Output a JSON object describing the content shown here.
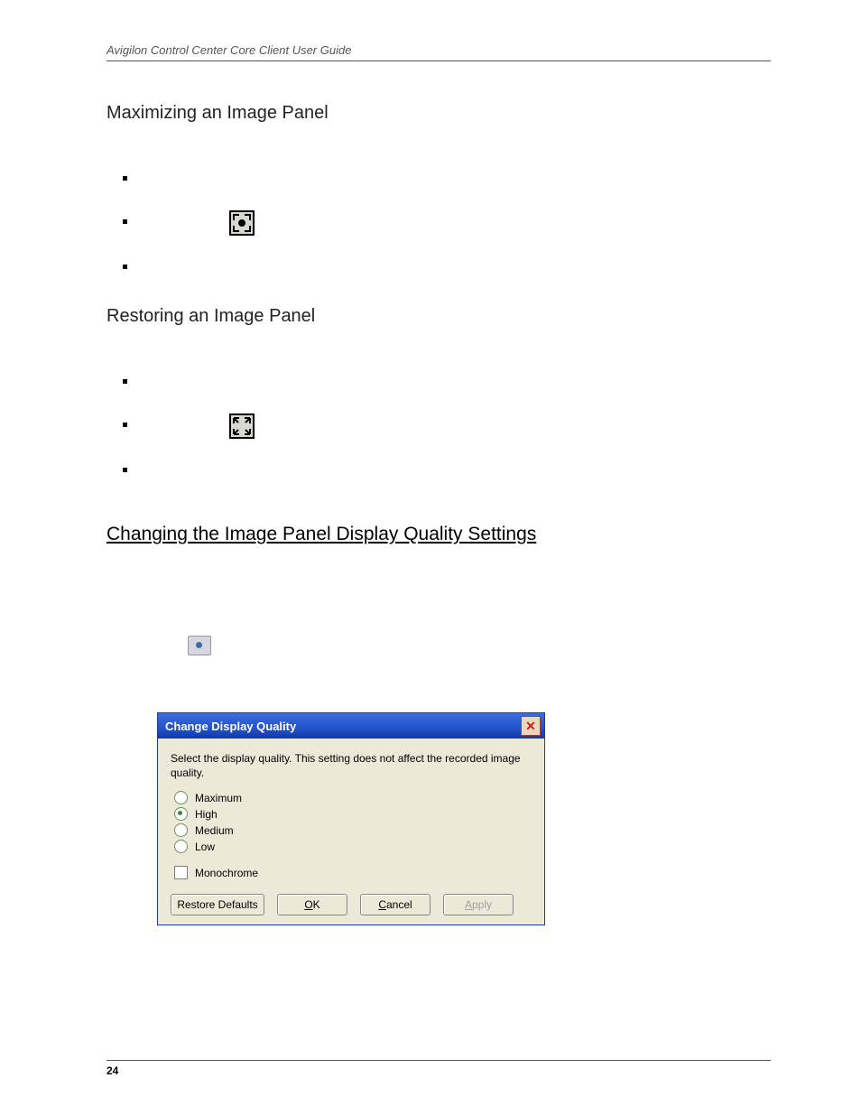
{
  "page": {
    "running_head": "Avigilon Control Center Core Client User Guide",
    "number": "24"
  },
  "sections": {
    "maximize_title": "Maximizing an Image Panel",
    "restore_title": "Restoring an Image Panel",
    "quality_title": "Changing the Image Panel Display Quality Settings"
  },
  "dialog": {
    "title": "Change Display Quality",
    "description": "Select the display quality.  This setting does not affect the recorded image quality.",
    "options": {
      "maximum": "Maximum",
      "high": "High",
      "medium": "Medium",
      "low": "Low"
    },
    "selected_option": "high",
    "monochrome_label": "Monochrome",
    "monochrome_checked": false,
    "buttons": {
      "restore_defaults": "Restore Defaults",
      "ok": "OK",
      "cancel": "Cancel",
      "apply": "Apply"
    }
  },
  "chart_data": {
    "type": "table",
    "title": "Change Display Quality dialog state",
    "rows": [
      {
        "control": "Maximum",
        "type": "radio",
        "state": "unselected"
      },
      {
        "control": "High",
        "type": "radio",
        "state": "selected"
      },
      {
        "control": "Medium",
        "type": "radio",
        "state": "unselected"
      },
      {
        "control": "Low",
        "type": "radio",
        "state": "unselected"
      },
      {
        "control": "Monochrome",
        "type": "checkbox",
        "state": "unchecked"
      }
    ],
    "buttons": [
      "Restore Defaults",
      "OK",
      "Cancel",
      "Apply (disabled)"
    ]
  }
}
